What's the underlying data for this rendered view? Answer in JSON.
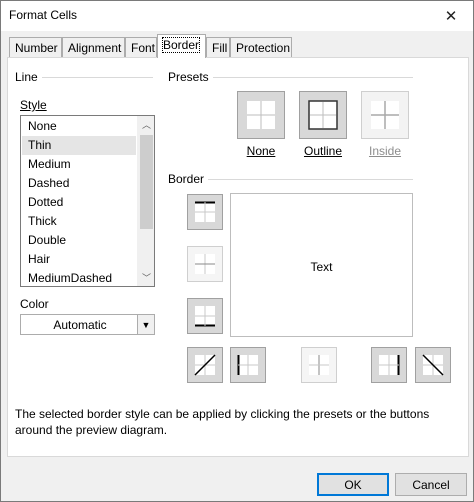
{
  "window": {
    "title": "Format Cells",
    "close_glyph": "✕"
  },
  "tabs": [
    {
      "label": "Number",
      "active": false
    },
    {
      "label": "Alignment",
      "active": false
    },
    {
      "label": "Font",
      "active": false
    },
    {
      "label": "Border",
      "active": true
    },
    {
      "label": "Fill",
      "active": false
    },
    {
      "label": "Protection",
      "active": false
    }
  ],
  "line": {
    "section_label": "Line",
    "style_label": "Style",
    "styles": [
      "None",
      "Thin",
      "Medium",
      "Dashed",
      "Dotted",
      "Thick",
      "Double",
      "Hair",
      "MediumDashed"
    ],
    "selected_style": "Thin",
    "color_label": "Color",
    "color_value": "Automatic"
  },
  "presets": {
    "section_label": "Presets",
    "items": [
      {
        "label": "None",
        "enabled": true,
        "icon": "border-none-icon"
      },
      {
        "label": "Outline",
        "enabled": true,
        "icon": "border-outline-icon"
      },
      {
        "label": "Inside",
        "enabled": false,
        "icon": "border-inside-icon"
      }
    ]
  },
  "border": {
    "section_label": "Border",
    "preview_text": "Text",
    "buttons": [
      "border-top-icon",
      "border-horizontal-inside-icon",
      "border-bottom-icon",
      "border-diagonal-up-icon",
      "border-left-icon",
      "border-vertical-inside-icon",
      "border-right-icon",
      "border-diagonal-down-icon"
    ]
  },
  "help_text": "The selected border style can be applied by clicking the presets or the buttons around the preview diagram.",
  "buttons": {
    "ok": "OK",
    "cancel": "Cancel"
  },
  "colors": {
    "dialog_bg": "#f0f0f0",
    "selected_row": "#e5e5e5",
    "default_button": "#0078d7"
  }
}
